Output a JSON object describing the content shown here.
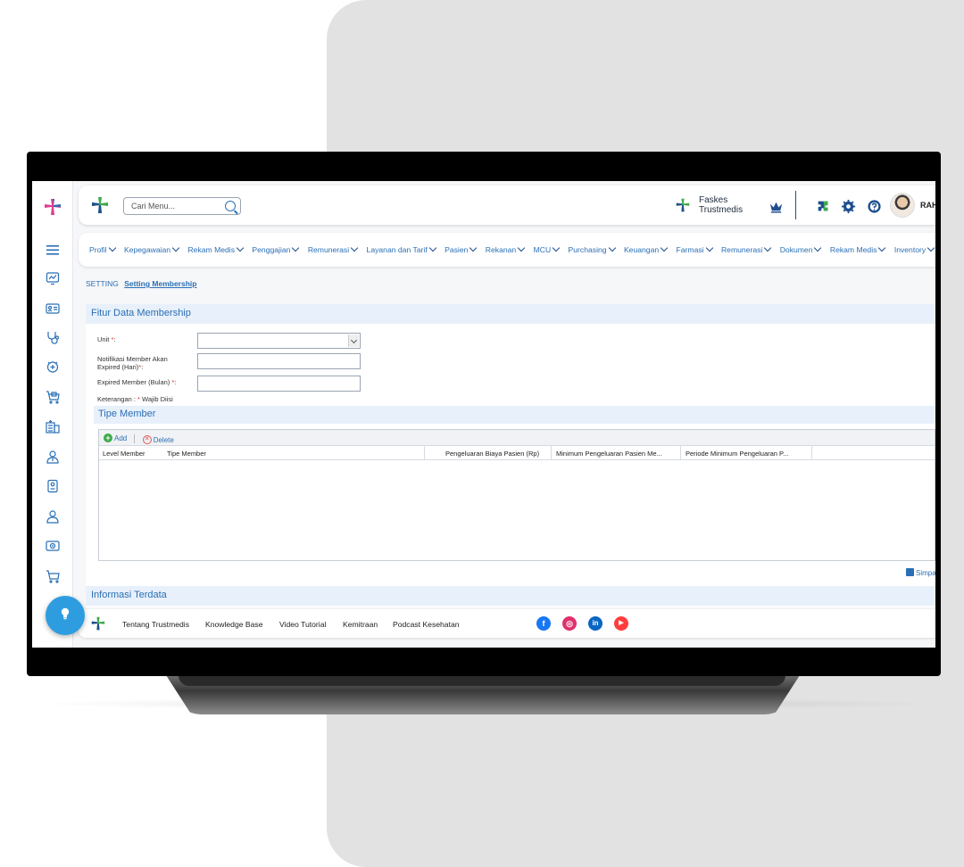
{
  "header": {
    "search_placeholder": "Cari Menu...",
    "faskes_line1": "Faskes",
    "faskes_line2": "Trustmedis",
    "user_name": "RAH"
  },
  "menu": {
    "items": [
      "Profil",
      "Kepegawaian",
      "Rekam Medis",
      "Penggajian",
      "Remunerasi",
      "Layanan dan Tarif",
      "Pasien",
      "Rekanan",
      "MCU",
      "Purchasing",
      "Keuangan",
      "Farmasi",
      "Remunerasi",
      "Dokumen",
      "Rekam Medis",
      "Inventory"
    ]
  },
  "breadcrumb": {
    "root": "SETTING",
    "current": "Setting Membership"
  },
  "form": {
    "title": "Fitur Data Membership",
    "unit_label": "Unit",
    "notif_label_1": "Notifikasi Member Akan",
    "notif_label_2": "Expired (Hari)",
    "expired_label": "Expired Member (Bulan)",
    "required_mark": "*",
    "colon": ":",
    "note_prefix": "Keterangan : ",
    "note_suffix": " Wajib Diisi"
  },
  "tipe_member": {
    "title": "Tipe Member",
    "add_label": "Add",
    "delete_label": "Delete",
    "columns": [
      "Level Member",
      "Tipe Member",
      "Pengeluaran Biaya Pasien (Rp)",
      "Minimum Pengeluaran Pasien Me...",
      "Periode Minimum Pengeluaran P..."
    ],
    "save_label": "Simpan"
  },
  "info": {
    "title": "Informasi Terdata"
  },
  "footer": {
    "links": [
      "Tentang Trustmedis",
      "Knowledge Base",
      "Video Tutorial",
      "Kemitraan",
      "Podcast Kesehatan"
    ]
  },
  "colors": {
    "accent": "#2a6fb5",
    "section_bg": "#e8f0fb",
    "panel_bg": "#e2e2e2",
    "brand_green": "#3eaa4b",
    "brand_blue": "#2a6fb5"
  },
  "icons": {
    "sidebar": [
      "menu-icon",
      "dashboard-icon",
      "id-card-icon",
      "stethoscope-icon",
      "clinic-icon",
      "cart-box-icon",
      "hospital-icon",
      "doctor-icon",
      "document-icon",
      "user-icon",
      "money-icon",
      "cart-icon"
    ]
  }
}
